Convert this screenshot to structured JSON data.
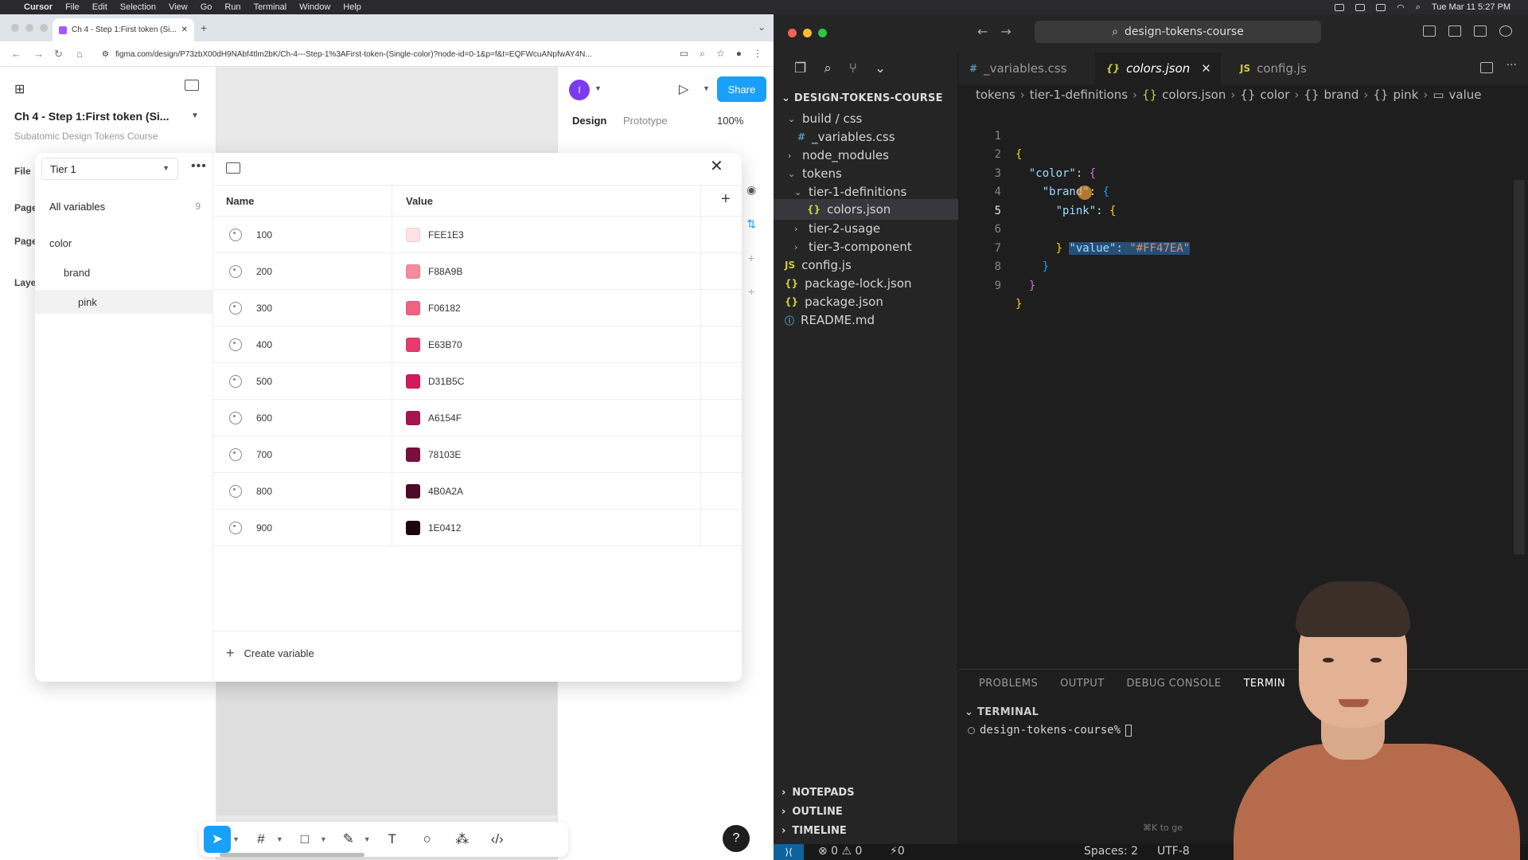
{
  "menubar": {
    "app": "Cursor",
    "items": [
      "File",
      "Edit",
      "Selection",
      "View",
      "Go",
      "Run",
      "Terminal",
      "Window",
      "Help"
    ],
    "clock": "Tue Mar 11  5:27 PM"
  },
  "browser": {
    "tab_title": "Ch 4 - Step 1:First token (Si...",
    "url": "figma.com/design/P73zbX00dH9NAbf4tlm2bK/Ch-4---Step-1%3AFirst-token-(Single-color)?node-id=0-1&p=f&t=EQFWcuANpfwAY4N..."
  },
  "figma": {
    "file_title": "Ch 4 - Step 1:First token (Si...",
    "subtitle": "Subatomic Design Tokens Course",
    "sidebar_labels": [
      "File",
      "Page",
      "Page",
      "Laye"
    ],
    "avatar_initial": "I",
    "share_label": "Share",
    "tabs": {
      "design": "Design",
      "prototype": "Prototype"
    },
    "zoom": "100%",
    "variables": {
      "collection": "Tier 1",
      "all_variables_label": "All variables",
      "all_variables_count": "9",
      "groups": [
        "color",
        "brand",
        "pink"
      ],
      "col_name": "Name",
      "col_value": "Value",
      "create_label": "Create variable",
      "rows": [
        {
          "name": "100",
          "value": "FEE1E3",
          "color": "#FEE1E3"
        },
        {
          "name": "200",
          "value": "F88A9B",
          "color": "#F88A9B"
        },
        {
          "name": "300",
          "value": "F06182",
          "color": "#F06182"
        },
        {
          "name": "400",
          "value": "E63B70",
          "color": "#E63B70"
        },
        {
          "name": "500",
          "value": "D31B5C",
          "color": "#D31B5C"
        },
        {
          "name": "600",
          "value": "A6154F",
          "color": "#A6154F"
        },
        {
          "name": "700",
          "value": "78103E",
          "color": "#78103E"
        },
        {
          "name": "800",
          "value": "4B0A2A",
          "color": "#4B0A2A"
        },
        {
          "name": "900",
          "value": "1E0412",
          "color": "#1E0412"
        }
      ]
    }
  },
  "editor": {
    "search": "design-tokens-course",
    "explorer_root": "DESIGN-TOKENS-COURSE",
    "tree": [
      {
        "label": "build / css",
        "type": "folder-open"
      },
      {
        "label": "_variables.css",
        "type": "css"
      },
      {
        "label": "node_modules",
        "type": "folder"
      },
      {
        "label": "tokens",
        "type": "folder-open"
      },
      {
        "label": "tier-1-definitions",
        "type": "folder-open"
      },
      {
        "label": "colors.json",
        "type": "json"
      },
      {
        "label": "tier-2-usage",
        "type": "folder"
      },
      {
        "label": "tier-3-component",
        "type": "folder"
      },
      {
        "label": "config.js",
        "type": "js"
      },
      {
        "label": "package-lock.json",
        "type": "json"
      },
      {
        "label": "package.json",
        "type": "json"
      },
      {
        "label": "README.md",
        "type": "info"
      }
    ],
    "bottom_sections": [
      "NOTEPADS",
      "OUTLINE",
      "TIMELINE"
    ],
    "tabs": [
      {
        "label": "_variables.css",
        "icon": "#"
      },
      {
        "label": "colors.json",
        "icon": "{}"
      },
      {
        "label": "config.js",
        "icon": "JS"
      }
    ],
    "breadcrumbs": [
      "tokens",
      "tier-1-definitions",
      "colors.json",
      "color",
      "brand",
      "pink",
      "value"
    ],
    "code_lines": [
      "1",
      "2",
      "3",
      "4",
      "5",
      "6",
      "7",
      "8",
      "9"
    ],
    "code": {
      "key_color": "\"color\"",
      "key_brand": "\"brand\"",
      "key_pink": "\"pink\"",
      "key_value": "\"value\"",
      "str_value": "\"#FF47EA\""
    },
    "panel_tabs": [
      "PROBLEMS",
      "OUTPUT",
      "DEBUG CONSOLE",
      "TERMIN"
    ],
    "terminal_header": "TERMINAL",
    "prompt": "design-tokens-course%",
    "hint": "⌘K to ge",
    "status": {
      "problems": "⊗ 0 ⚠ 0",
      "ports": "⚡0",
      "spaces": "Spaces: 2",
      "encoding": "UTF-8"
    }
  }
}
